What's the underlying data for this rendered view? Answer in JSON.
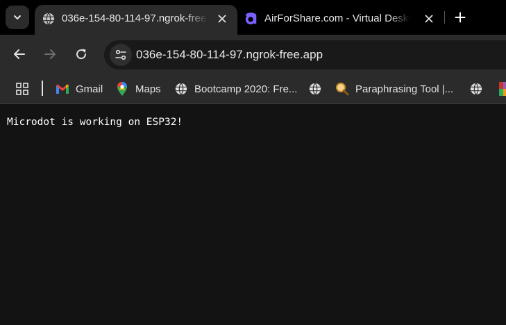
{
  "tabs": {
    "search_icon": "chevron-down-icon",
    "active": {
      "title": "036e-154-80-114-97.ngrok-free.app",
      "favicon": "globe-icon"
    },
    "inactive": {
      "title": "AirForShare.com - Virtual Desktop",
      "favicon": "airforshare-a-icon",
      "favicon_color": "#6c5ce7"
    },
    "new_tab_icon": "plus-icon"
  },
  "toolbar": {
    "back_icon": "back-arrow-icon",
    "forward_icon": "forward-arrow-icon",
    "reload_icon": "reload-icon",
    "site_info_icon": "tune-icon",
    "url": "036e-154-80-114-97.ngrok-free.app"
  },
  "bookmarks": {
    "apps_icon": "apps-grid-icon",
    "items": [
      {
        "label": "Gmail",
        "icon": "gmail-icon"
      },
      {
        "label": "Maps",
        "icon": "maps-pin-icon"
      },
      {
        "label": "Bootcamp 2020: Fre...",
        "icon": "globe-icon"
      },
      {
        "label": "",
        "icon": "globe-icon"
      },
      {
        "label": "Paraphrasing Tool |...",
        "icon": "magnifier-icon"
      },
      {
        "label": "",
        "icon": "globe-icon"
      }
    ]
  },
  "page": {
    "text": "Microdot is working on ESP32!"
  },
  "colors": {
    "tab_strip": "#000000",
    "toolbar": "#2b2b2b",
    "content_bg": "#131313",
    "text": "#ffffff"
  }
}
